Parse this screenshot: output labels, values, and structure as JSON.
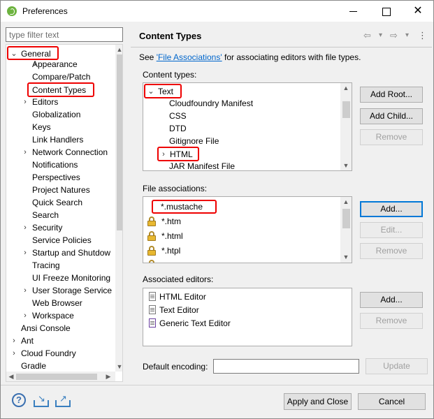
{
  "window": {
    "title": "Preferences",
    "close_glyph": "✕"
  },
  "filter": {
    "placeholder": "type filter text"
  },
  "tree": {
    "items": [
      {
        "label": "General",
        "expander": "⌄"
      },
      {
        "label": "Appearance",
        "expander": "›"
      },
      {
        "label": "Compare/Patch"
      },
      {
        "label": "Content Types"
      },
      {
        "label": "Editors",
        "expander": "›"
      },
      {
        "label": "Globalization"
      },
      {
        "label": "Keys"
      },
      {
        "label": "Link Handlers"
      },
      {
        "label": "Network Connection",
        "expander": "›"
      },
      {
        "label": "Notifications"
      },
      {
        "label": "Perspectives"
      },
      {
        "label": "Project Natures"
      },
      {
        "label": "Quick Search"
      },
      {
        "label": "Search"
      },
      {
        "label": "Security",
        "expander": "›"
      },
      {
        "label": "Service Policies"
      },
      {
        "label": "Startup and Shutdow",
        "expander": "›"
      },
      {
        "label": "Tracing"
      },
      {
        "label": "UI Freeze Monitoring"
      },
      {
        "label": "User Storage Service",
        "expander": "›"
      },
      {
        "label": "Web Browser"
      },
      {
        "label": "Workspace",
        "expander": "›"
      },
      {
        "label": "Ansi Console"
      },
      {
        "label": "Ant",
        "expander": "›"
      },
      {
        "label": "Cloud Foundry",
        "expander": "›"
      },
      {
        "label": "Gradle"
      }
    ]
  },
  "page": {
    "title": "Content Types",
    "see_prefix": "See ",
    "see_link": "'File Associations'",
    "see_suffix": " for associating editors with file types.",
    "content_types_label": "Content types:",
    "file_assoc_label": "File associations:",
    "assoc_editors_label": "Associated editors:",
    "default_encoding_label": "Default encoding:"
  },
  "content_types": [
    {
      "label": "Text",
      "expander": "⌄"
    },
    {
      "label": "Cloudfoundry Manifest"
    },
    {
      "label": "CSS"
    },
    {
      "label": "DTD"
    },
    {
      "label": "Gitignore File"
    },
    {
      "label": "HTML",
      "expander": "›"
    },
    {
      "label": "JAR Manifest File"
    }
  ],
  "file_associations": [
    "*.mustache",
    "*.htm",
    "*.html",
    "*.htpl"
  ],
  "associated_editors": [
    "HTML Editor",
    "Text Editor",
    "Generic Text Editor"
  ],
  "buttons": {
    "add_root": "Add Root...",
    "add_child": "Add Child...",
    "remove": "Remove",
    "add_dots": "Add...",
    "edit": "Edit...",
    "add": "Add...",
    "update": "Update",
    "apply_close": "Apply and Close",
    "cancel": "Cancel"
  },
  "icons": {
    "nav_back": "⇦",
    "nav_forward": "⇨",
    "dropdown": "▾",
    "menu": "⋮",
    "help": "?",
    "import_arrow": "↘",
    "export_arrow": "↗"
  }
}
